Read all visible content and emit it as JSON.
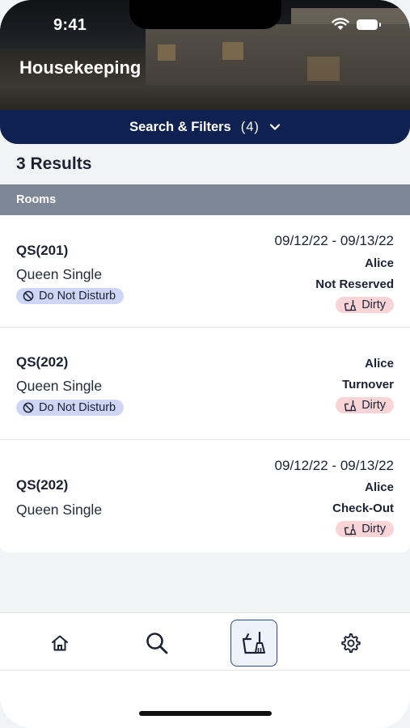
{
  "status_bar": {
    "time": "9:41"
  },
  "app": {
    "title": "Housekeeping"
  },
  "filters": {
    "label": "Search & Filters",
    "count": "(4)"
  },
  "results": {
    "summary": "3 Results"
  },
  "section": {
    "title": "Rooms"
  },
  "rooms": [
    {
      "code": "QS(201)",
      "type": "Queen Single",
      "dnd_label": "Do Not Disturb",
      "dates": "09/12/22 - 09/13/22",
      "assignee": "Alice",
      "reservation": "Not Reserved",
      "status": "Dirty"
    },
    {
      "code": "QS(202)",
      "type": "Queen Single",
      "dnd_label": "Do Not Disturb",
      "dates": "",
      "assignee": "Alice",
      "reservation": "Turnover",
      "status": "Dirty"
    },
    {
      "code": "QS(202)",
      "type": "Queen Single",
      "dnd_label": "",
      "dates": "09/12/22 - 09/13/22",
      "assignee": "Alice",
      "reservation": "Check-Out",
      "status": "Dirty"
    }
  ],
  "tabbar": {
    "items": [
      {
        "icon": "home-icon",
        "active": false
      },
      {
        "icon": "search-icon",
        "active": false
      },
      {
        "icon": "housekeeping-icon",
        "active": true
      },
      {
        "icon": "gear-icon",
        "active": false
      }
    ]
  },
  "colors": {
    "navy": "#0f2150",
    "section": "#7e8796",
    "dnd_bg": "#cdd6f4",
    "dirty_bg": "#f8d4d6",
    "active_tab": "#2f4a8c"
  }
}
